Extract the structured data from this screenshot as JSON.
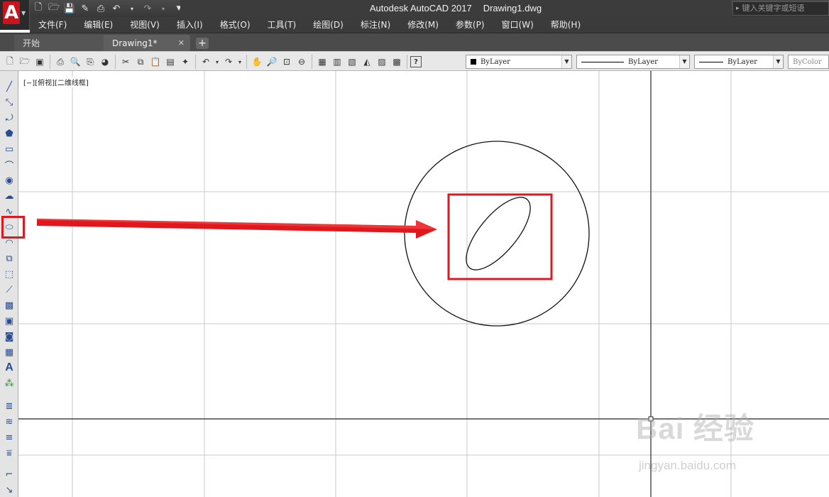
{
  "app": {
    "logo_letter": "A",
    "title_app": "Autodesk AutoCAD 2017",
    "title_file": "Drawing1.dwg",
    "search_placeholder": "键入关键字或短语"
  },
  "quick_access": [
    "new-icon",
    "open-icon",
    "save-icon",
    "save-as-icon",
    "plot-icon",
    "undo-icon",
    "redo-icon",
    "customize-icon"
  ],
  "menu": {
    "items": [
      "文件(F)",
      "编辑(E)",
      "视图(V)",
      "插入(I)",
      "格式(O)",
      "工具(T)",
      "绘图(D)",
      "标注(N)",
      "修改(M)",
      "参数(P)",
      "窗口(W)",
      "帮助(H)"
    ]
  },
  "tabs": {
    "start": "开始",
    "drawing": "Drawing1*",
    "close": "✕",
    "add": "+"
  },
  "toolbar": {
    "color_value": "ByLayer",
    "linetype_value": "ByLayer",
    "lineweight_value": "ByLayer",
    "plotstyle_value": "ByColor"
  },
  "left_toolbar": {
    "highlighted_tool": "ellipse-tool"
  },
  "drawing": {
    "viewport_label": "[−][俯视][二维线框]",
    "highlight_color": "#e0171c"
  },
  "watermark": {
    "brand": "Bai 经验",
    "url": "jingyan.baidu.com"
  }
}
